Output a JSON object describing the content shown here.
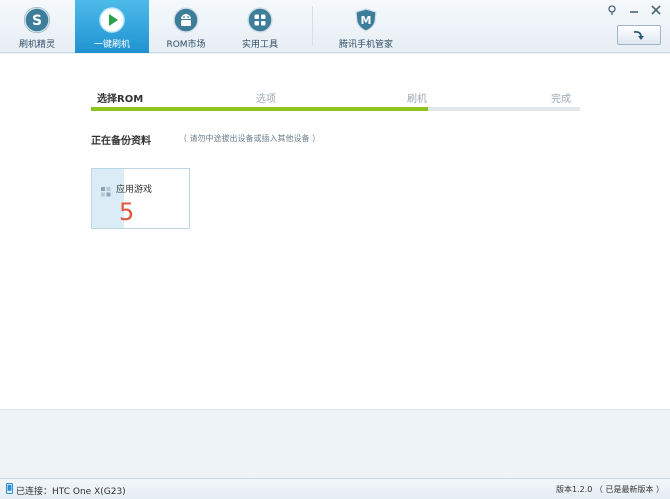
{
  "nav": {
    "items": [
      {
        "label": "刷机精灵",
        "icon": "s-logo-icon",
        "active": false
      },
      {
        "label": "一键刷机",
        "icon": "play-icon",
        "active": true
      },
      {
        "label": "ROM市场",
        "icon": "android-icon",
        "active": false
      },
      {
        "label": "实用工具",
        "icon": "grid-icon",
        "active": false
      },
      {
        "label": "腾讯手机管家",
        "icon": "shield-m-icon",
        "active": false
      }
    ]
  },
  "window": {
    "controls": [
      "pin-icon",
      "minimize-icon",
      "close-icon"
    ]
  },
  "refresh": {
    "icon": "refresh-arrow-icon"
  },
  "steps": {
    "items": [
      "选择ROM",
      "选项",
      "刷机",
      "完成"
    ],
    "current_index": 0,
    "progress_fraction": 0.69
  },
  "backup": {
    "title": "正在备份资料",
    "hint": "（ 请勿中途拔出设备或插入其他设备 ）",
    "card": {
      "label": "应用游戏",
      "count": "5",
      "icon": "apps-grid-icon"
    }
  },
  "status": {
    "device_label": "已连接：HTC One X(G23)",
    "version": "版本1.2.0 （ 已是最新版本 ）"
  },
  "colors": {
    "accent": "#1f93d1",
    "progress": "#8dc21f",
    "count": "#e0573a"
  }
}
